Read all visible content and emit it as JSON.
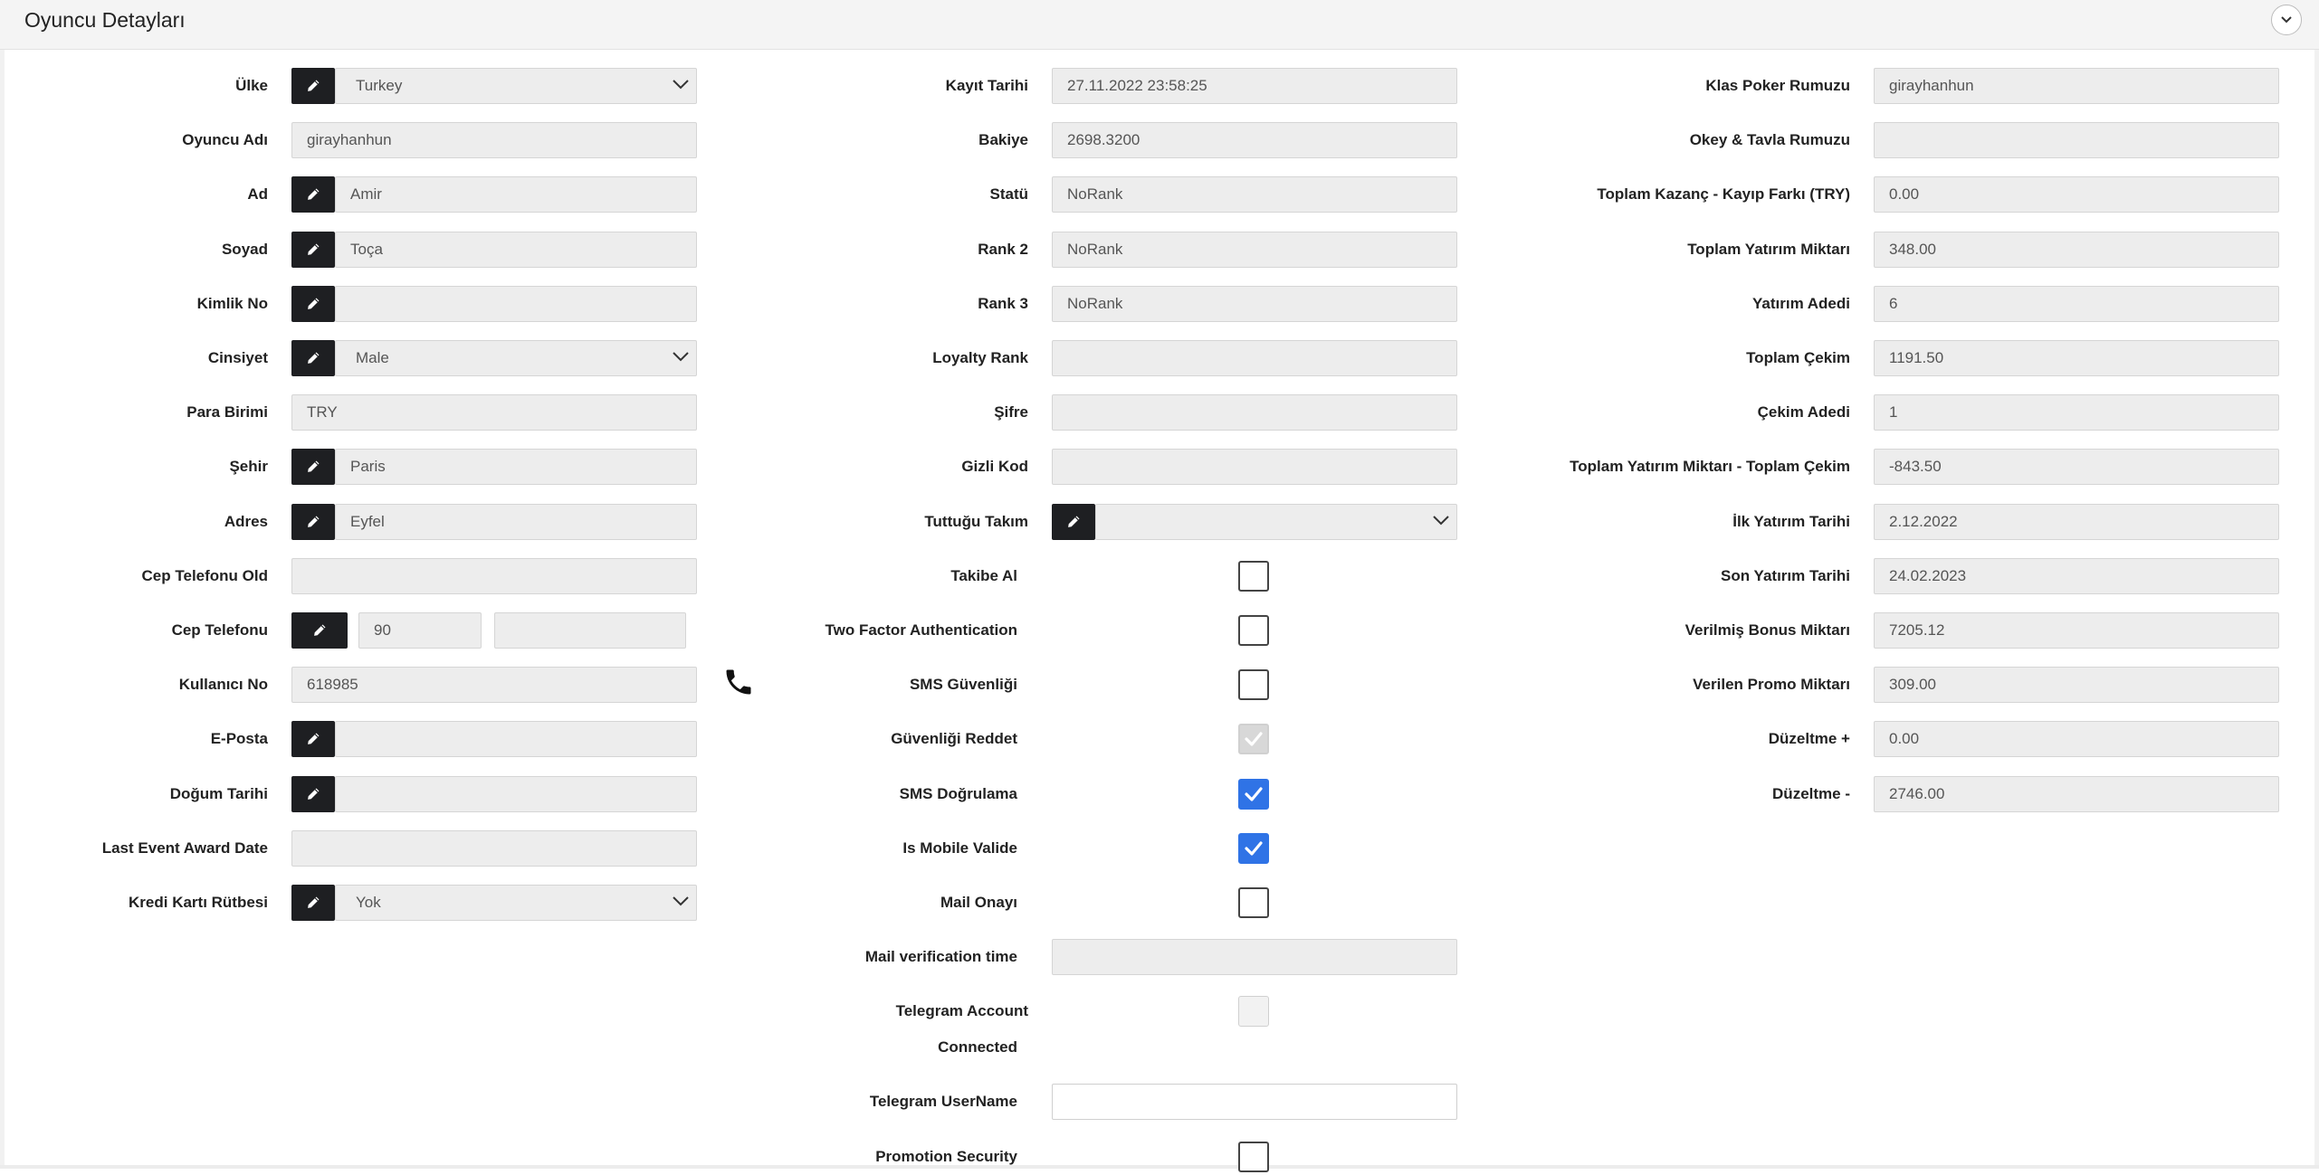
{
  "panel": {
    "title": "Oyuncu Detayları",
    "collapse_icon": "chevron-down-icon"
  },
  "left": {
    "rows": [
      {
        "key": "country",
        "label": "Ülke",
        "value": "Turkey",
        "editable": true,
        "dropdown": true
      },
      {
        "key": "player_name",
        "label": "Oyuncu Adı",
        "value": "girayhanhun",
        "editable": false
      },
      {
        "key": "first_name",
        "label": "Ad",
        "value": "Amir",
        "editable": true
      },
      {
        "key": "last_name",
        "label": "Soyad",
        "value": "Toça",
        "editable": true
      },
      {
        "key": "id_no",
        "label": "Kimlik No",
        "value": "",
        "editable": true
      },
      {
        "key": "gender",
        "label": "Cinsiyet",
        "value": "Male",
        "editable": true,
        "dropdown": true
      },
      {
        "key": "currency",
        "label": "Para Birimi",
        "value": "TRY",
        "editable": false
      },
      {
        "key": "city",
        "label": "Şehir",
        "value": "Paris",
        "editable": true
      },
      {
        "key": "address",
        "label": "Adres",
        "value": "Eyfel",
        "editable": true
      },
      {
        "key": "old_mobile",
        "label": "Cep Telefonu Old",
        "value": "",
        "editable": false
      },
      {
        "key": "mobile",
        "label": "Cep Telefonu",
        "country_code": "90",
        "number": "",
        "editable": true
      },
      {
        "key": "user_no",
        "label": "Kullanıcı No",
        "value": "618985",
        "editable": false
      },
      {
        "key": "email",
        "label": "E-Posta",
        "value": "",
        "editable": true
      },
      {
        "key": "birth_date",
        "label": "Doğum Tarihi",
        "value": "",
        "editable": true
      },
      {
        "key": "last_event_award",
        "label": "Last Event Award Date",
        "value": "",
        "editable": false
      },
      {
        "key": "credit_card_rank",
        "label": "Kredi Kartı Rütbesi",
        "value": "Yok",
        "editable": true,
        "dropdown": true
      }
    ]
  },
  "middle": {
    "rows": [
      {
        "key": "register_date",
        "label": "Kayıt Tarihi",
        "type": "text",
        "value": "27.11.2022 23:58:25"
      },
      {
        "key": "balance",
        "label": "Bakiye",
        "type": "text",
        "value": "2698.3200"
      },
      {
        "key": "status",
        "label": "Statü",
        "type": "text",
        "value": "NoRank"
      },
      {
        "key": "rank2",
        "label": "Rank 2",
        "type": "text",
        "value": "NoRank"
      },
      {
        "key": "rank3",
        "label": "Rank 3",
        "type": "text",
        "value": "NoRank"
      },
      {
        "key": "loyalty_rank",
        "label": "Loyalty Rank",
        "type": "text",
        "value": ""
      },
      {
        "key": "password",
        "label": "Şifre",
        "type": "text",
        "value": ""
      },
      {
        "key": "secret_code",
        "label": "Gizli Kod",
        "type": "text",
        "value": ""
      },
      {
        "key": "team",
        "label": "Tuttuğu Takım",
        "type": "select",
        "value": ""
      },
      {
        "key": "follow",
        "label": "Takibe Al",
        "type": "checkbox",
        "state": "unchecked"
      },
      {
        "key": "two_factor",
        "label": "Two Factor Authentication",
        "type": "checkbox",
        "state": "unchecked"
      },
      {
        "key": "sms_security",
        "label": "SMS Güvenliği",
        "type": "checkbox",
        "state": "unchecked"
      },
      {
        "key": "reject_security",
        "label": "Güvenliği Reddet",
        "type": "checkbox",
        "state": "disabled-checked"
      },
      {
        "key": "sms_verify",
        "label": "SMS Doğrulama",
        "type": "checkbox",
        "state": "checked"
      },
      {
        "key": "is_mobile_valid",
        "label": "Is Mobile Valide",
        "type": "checkbox",
        "state": "checked"
      },
      {
        "key": "mail_confirm",
        "label": "Mail Onayı",
        "type": "checkbox",
        "state": "unchecked"
      },
      {
        "key": "mail_verify_time",
        "label": "Mail verification time",
        "type": "text",
        "value": ""
      },
      {
        "key": "telegram_connected",
        "label_line1": "Telegram Account",
        "label_line2": "Connected",
        "type": "checkbox",
        "state": "disabled"
      },
      {
        "key": "telegram_username",
        "label": "Telegram UserName",
        "type": "input",
        "value": ""
      },
      {
        "key": "promotion_security",
        "label": "Promotion Security",
        "type": "checkbox",
        "state": "unchecked"
      }
    ]
  },
  "right": {
    "rows": [
      {
        "key": "poker_nick",
        "label": "Klas Poker Rumuzu",
        "value": "girayhanhun"
      },
      {
        "key": "okey_nick",
        "label": "Okey & Tavla Rumuzu",
        "value": ""
      },
      {
        "key": "win_loss",
        "label": "Toplam Kazanç - Kayıp Farkı (TRY)",
        "value": "0.00"
      },
      {
        "key": "total_deposit",
        "label": "Toplam Yatırım Miktarı",
        "value": "348.00"
      },
      {
        "key": "deposit_count",
        "label": "Yatırım Adedi",
        "value": "6"
      },
      {
        "key": "total_withdraw",
        "label": "Toplam Çekim",
        "value": "1191.50"
      },
      {
        "key": "withdraw_count",
        "label": "Çekim Adedi",
        "value": "1"
      },
      {
        "key": "deposit_minus_withdraw",
        "label": "Toplam Yatırım Miktarı - Toplam Çekim",
        "value": "-843.50"
      },
      {
        "key": "first_deposit",
        "label": "İlk Yatırım Tarihi",
        "value": "2.12.2022"
      },
      {
        "key": "last_deposit",
        "label": "Son Yatırım Tarihi",
        "value": "24.02.2023"
      },
      {
        "key": "bonus_given",
        "label": "Verilmiş Bonus Miktarı",
        "value": "7205.12"
      },
      {
        "key": "promo_given",
        "label": "Verilen Promo Miktarı",
        "value": "309.00"
      },
      {
        "key": "adjust_plus",
        "label": "Düzeltme +",
        "value": "0.00"
      },
      {
        "key": "adjust_minus",
        "label": "Düzeltme -",
        "value": "2746.00"
      }
    ]
  },
  "icons": {
    "edit": "pencil-icon",
    "dropdown": "chevron-down-icon",
    "phone": "phone-icon",
    "check": "check-icon"
  }
}
